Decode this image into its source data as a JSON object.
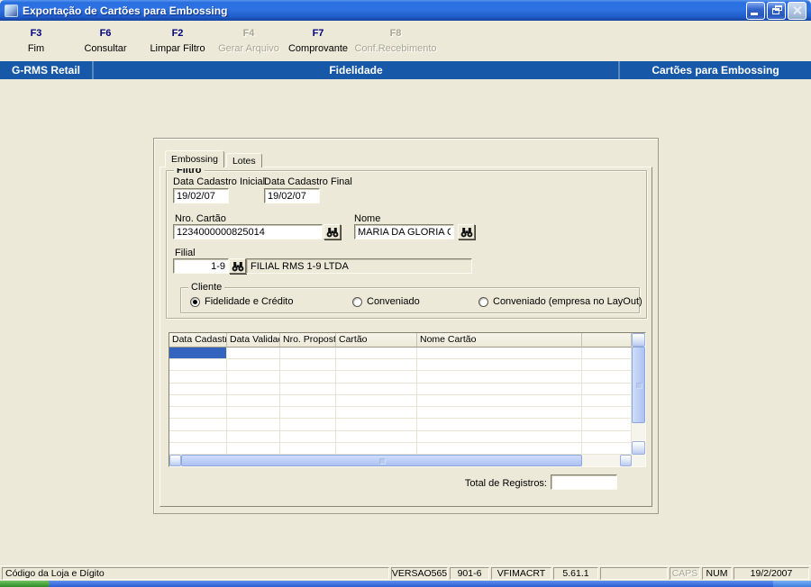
{
  "window": {
    "title": "Exportação de Cartões para Embossing"
  },
  "toolbar": {
    "items": [
      {
        "key": "F3",
        "label": "Fim",
        "enabled": true
      },
      {
        "key": "F6",
        "label": "Consultar",
        "enabled": true
      },
      {
        "key": "F2",
        "label": "Limpar Filtro",
        "enabled": true
      },
      {
        "key": "F4",
        "label": "Gerar Arquivo",
        "enabled": false
      },
      {
        "key": "F7",
        "label": "Comprovante",
        "enabled": true
      },
      {
        "key": "F8",
        "label": "Conf.Recebimento",
        "enabled": false
      }
    ]
  },
  "navbar": {
    "left": "G-RMS Retail",
    "center": "Fidelidade",
    "right": "Cartões para Embossing"
  },
  "tabs": [
    {
      "label": "Embossing",
      "active": true
    },
    {
      "label": "Lotes",
      "active": false
    }
  ],
  "filter": {
    "legend": "Filtro",
    "date_start": {
      "label": "Data Cadastro Inicial",
      "value": "19/02/07"
    },
    "date_end": {
      "label": "Data Cadastro Final",
      "value": "19/02/07"
    },
    "card_number": {
      "label": "Nro. Cartão",
      "value": "1234000000825014"
    },
    "customer_name": {
      "label": "Nome",
      "value": "MARIA DA GLORIA CELESTINOteste"
    },
    "branch": {
      "label": "Filial",
      "code": "1-9",
      "description": "FILIAL RMS 1-9 LTDA"
    }
  },
  "client_type": {
    "legend": "Cliente",
    "options": [
      {
        "label": "Fidelidade e Crédito",
        "selected": true
      },
      {
        "label": "Conveniado",
        "selected": false
      },
      {
        "label": "Conveniado (empresa no LayOut)",
        "selected": false
      }
    ]
  },
  "grid": {
    "columns": [
      "Data Cadastro",
      "Data Validade",
      "Nro. Proposta",
      "Cartão",
      "Nome Cartão",
      ""
    ],
    "row_count": 9,
    "rows": [],
    "selected_cell": {
      "row": 0,
      "col": 0
    }
  },
  "total": {
    "label": "Total de Registros:",
    "value": ""
  },
  "statusbar": {
    "panels": [
      {
        "text": "Código da Loja e Dígito",
        "dim": false
      },
      {
        "text": "VERSAO565",
        "dim": false
      },
      {
        "text": "901-6",
        "dim": false
      },
      {
        "text": "VFIMACRT",
        "dim": false
      },
      {
        "text": "5.61.1",
        "dim": false
      },
      {
        "text": "",
        "dim": false
      },
      {
        "text": "CAPS",
        "dim": true
      },
      {
        "text": "NUM",
        "dim": false
      },
      {
        "text": "19/2/2007",
        "dim": false
      }
    ]
  },
  "colors": {
    "navbar_blue": "#1758A8",
    "selection_blue": "#3364BE",
    "titlebar_blue": "#2A6FE0"
  }
}
